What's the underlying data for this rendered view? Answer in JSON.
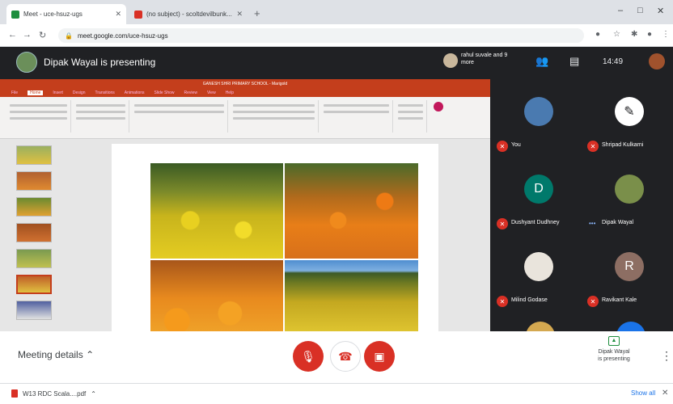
{
  "browser": {
    "tabs": [
      {
        "label": "Meet - uce-hsuz-ugs",
        "active": true,
        "favicon_color": "#1e8e3e"
      },
      {
        "label": "(no subject) - scoltdevilbunk...",
        "active": false,
        "favicon_color": "#d93025"
      }
    ],
    "url": "meet.google.com/uce-hsuz-ugs"
  },
  "meet": {
    "presenting_title": "Dipak Wayal is presenting",
    "top_people": "rahul suvale and 9 more",
    "time": "14:49",
    "me_label": "You"
  },
  "slides_app": {
    "window_title": "GANESH SHRI PRIMARY SCHOOL - Marigold",
    "ribbon_tabs": [
      "File",
      "Home",
      "Insert",
      "Design",
      "Transitions",
      "Animations",
      "Slide Show",
      "Review",
      "View",
      "Help"
    ],
    "active_ribbon_tab": "Home",
    "thumbnail_count": 7,
    "selected_thumbnail": 6
  },
  "participants": [
    {
      "name": "You",
      "initial": "",
      "avatar_color": "#4a7ab0",
      "muted": true,
      "kind": "photo"
    },
    {
      "name": "Shripad Kulkarni",
      "initial": "",
      "avatar_color": "#ffffff",
      "muted": true,
      "kind": "photo"
    },
    {
      "name": "Dushyant Dudhney",
      "initial": "D",
      "avatar_color": "#00796b",
      "muted": true,
      "kind": "letter"
    },
    {
      "name": "Dipak Wayal",
      "initial": "",
      "avatar_color": "#7a8f4a",
      "muted": false,
      "kind": "photo"
    },
    {
      "name": "Milind Godase",
      "initial": "",
      "avatar_color": "#e9e4dc",
      "muted": true,
      "kind": "photo"
    },
    {
      "name": "Ravikant Kale",
      "initial": "R",
      "avatar_color": "#8d6e63",
      "muted": true,
      "kind": "letter"
    }
  ],
  "bottom_bar": {
    "meeting_details": "Meeting details",
    "presenting_line1": "Dipak Wayal",
    "presenting_line2": "is presenting",
    "colors": {
      "danger": "#d93025",
      "present": "#1e8e3e"
    }
  },
  "downloads": {
    "file": "W13 RDC Scala....pdf",
    "show_all": "Show all"
  }
}
